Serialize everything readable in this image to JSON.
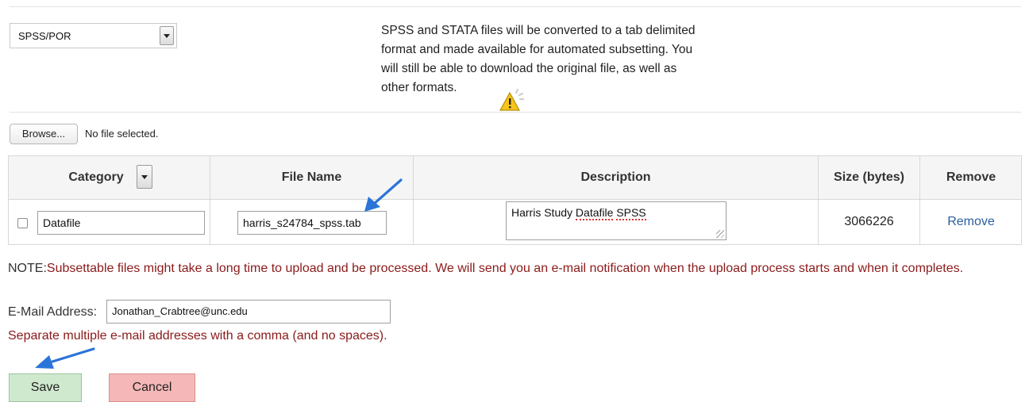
{
  "format_select": {
    "value": "SPSS/POR"
  },
  "info_text": "SPSS and STATA files will be converted to a tab delimited format and made available for automated subsetting. You will still be able to download the original file, as well as other formats.",
  "browse": {
    "button_label": "Browse...",
    "status": "No file selected."
  },
  "table": {
    "headers": [
      "Category",
      "File Name",
      "Description",
      "Size (bytes)",
      "Remove"
    ],
    "row": {
      "category": "Datafile",
      "file_name": "harris_s24784_spss.tab",
      "description_prefix": "Harris Study ",
      "description_misspelled_1": "Datafile",
      "description_space": " ",
      "description_misspelled_2": "SPSS",
      "size": "3066226",
      "remove_label": "Remove"
    }
  },
  "note": {
    "lead": "NOTE:",
    "text": "Subsettable files might take a long time to upload and be processed. We will send you an e-mail notification when the upload process starts and when it completes."
  },
  "email": {
    "label": "E-Mail Address:",
    "value": "Jonathan_Crabtree@unc.edu",
    "hint": "Separate multiple e-mail addresses with a comma (and no spaces)."
  },
  "buttons": {
    "save": "Save",
    "cancel": "Cancel"
  },
  "icons": {
    "warning": "warning-icon",
    "pointer_arrow": "arrow-pointer-icon"
  },
  "colors": {
    "save_bg": "#cfe9cf",
    "cancel_bg": "#f5b7b7",
    "link": "#2a5f9e",
    "note": "#8b1a1a",
    "arrow": "#2b74d8"
  }
}
